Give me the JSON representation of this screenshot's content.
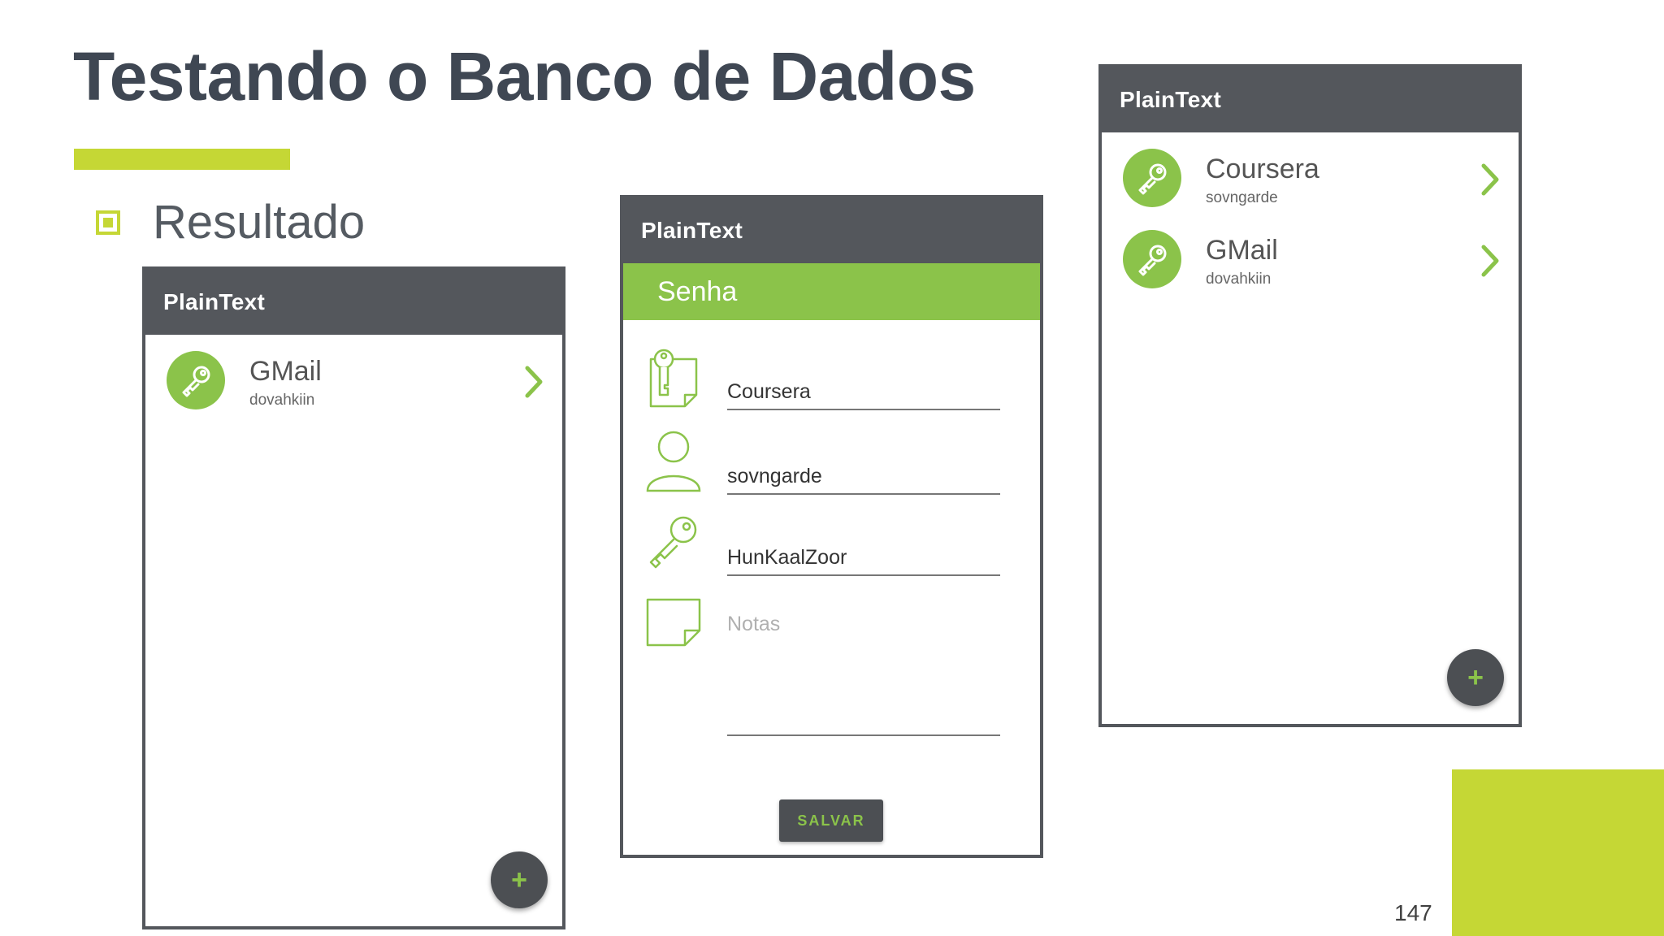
{
  "slide": {
    "title": "Testando o Banco de Dados",
    "bullet": "Resultado",
    "page_number": "147",
    "accent_color": "#c5d735"
  },
  "app": {
    "name": "PlainText",
    "primary_color": "#8bc34a",
    "appbar_color": "#54575c"
  },
  "screen_list_single": {
    "items": [
      {
        "title": "GMail",
        "subtitle": "dovahkiin",
        "icon": "key-icon"
      }
    ],
    "fab_label": "+"
  },
  "screen_form": {
    "section_title": "Senha",
    "fields": {
      "site": {
        "value": "Coursera",
        "icon": "site-key-card-icon"
      },
      "user": {
        "value": "sovngarde",
        "icon": "person-icon"
      },
      "password": {
        "value": "HunKaalZoor",
        "icon": "key-icon"
      },
      "notes": {
        "placeholder": "Notas",
        "icon": "note-icon"
      }
    },
    "save_label": "SALVAR"
  },
  "screen_list_double": {
    "items": [
      {
        "title": "Coursera",
        "subtitle": "sovngarde",
        "icon": "key-icon"
      },
      {
        "title": "GMail",
        "subtitle": "dovahkiin",
        "icon": "key-icon"
      }
    ],
    "fab_label": "+"
  }
}
